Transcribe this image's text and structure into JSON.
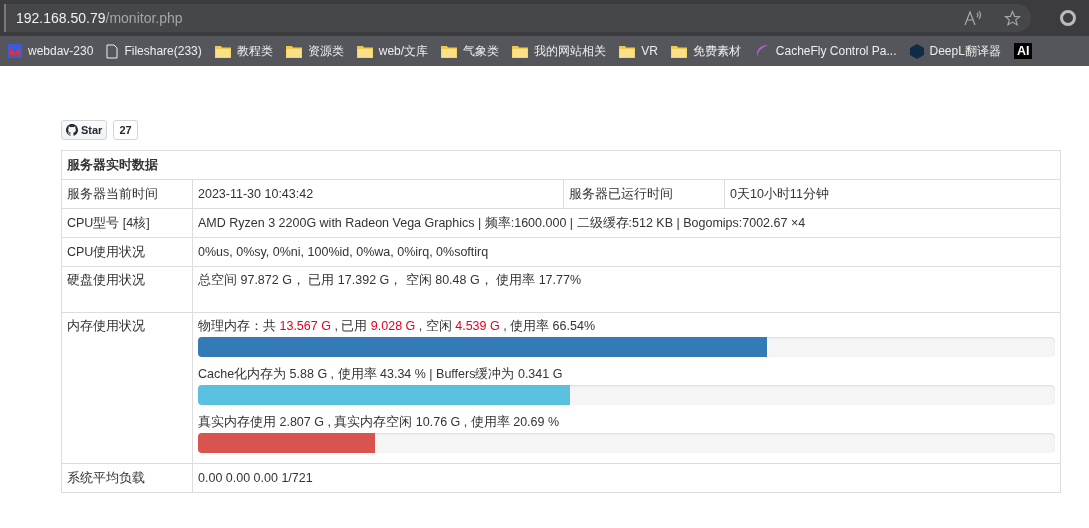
{
  "browser": {
    "address_host": "192.168.50.79",
    "address_path": "/monitor.php",
    "bookmarks": [
      {
        "kind": "mail",
        "label": "webdav-230"
      },
      {
        "kind": "page",
        "label": "Fileshare(233)"
      },
      {
        "kind": "folder",
        "label": "教程类"
      },
      {
        "kind": "folder",
        "label": "资源类"
      },
      {
        "kind": "folder",
        "label": "web/文库"
      },
      {
        "kind": "folder",
        "label": "气象类"
      },
      {
        "kind": "folder",
        "label": "我的网站相关"
      },
      {
        "kind": "folder",
        "label": "VR"
      },
      {
        "kind": "folder",
        "label": "免费素材"
      },
      {
        "kind": "cachefly",
        "label": "CacheFly Control Pa..."
      },
      {
        "kind": "deepl",
        "label": "DeepL翻译器"
      },
      {
        "kind": "ai",
        "label": "AI"
      }
    ]
  },
  "github": {
    "button": "Star",
    "count": "27"
  },
  "table": {
    "title": "服务器实时数据",
    "time_row": {
      "label": "服务器当前时间",
      "value": "2023-11-30 10:43:42",
      "label_2": "服务器已运行时间",
      "value_2": "0天10小时11分钟"
    },
    "cpu_model": {
      "label": "CPU型号 [4核]",
      "value": "AMD Ryzen 3 2200G with Radeon Vega Graphics | 频率:1600.000 | 二级缓存:512 KB | Bogomips:7002.67 ×4"
    },
    "cpu_usage": {
      "label": "CPU使用状况",
      "value": "0%us, 0%sy, 0%ni, 100%id, 0%wa, 0%irq, 0%softirq"
    },
    "disk": {
      "label": "硬盘使用状况",
      "value": "总空间 97.872 G， 已用 17.392 G， 空闲 80.48 G， 使用率 17.77%"
    },
    "memory": {
      "label": "内存使用状况",
      "bars": [
        {
          "color": "#337ab7",
          "level": 0.664,
          "parts": [
            {
              "text": "物理内存：共 ",
              "highlight": false
            },
            {
              "text": "13.567 G",
              "highlight": true
            },
            {
              "text": " , 已用 ",
              "highlight": false
            },
            {
              "text": "9.028 G",
              "highlight": true
            },
            {
              "text": " , 空闲 ",
              "highlight": false
            },
            {
              "text": "4.539 G",
              "highlight": true
            },
            {
              "text": " , 使用率 66.54%",
              "highlight": false
            }
          ]
        },
        {
          "color": "#5bc0de",
          "level": 0.434,
          "parts": [
            {
              "text": "Cache化内存为 5.88 G , 使用率 43.34 % | Buffers缓冲为 0.341 G",
              "highlight": false
            }
          ]
        },
        {
          "color": "#d9534f",
          "level": 0.206,
          "parts": [
            {
              "text": "真实内存使用 2.807 G , 真实内存空闲 10.76 G , 使用率 20.69 %",
              "highlight": false
            }
          ]
        }
      ]
    },
    "load": {
      "label": "系统平均负载",
      "value": "0.00 0.00 0.00 1/721"
    }
  }
}
